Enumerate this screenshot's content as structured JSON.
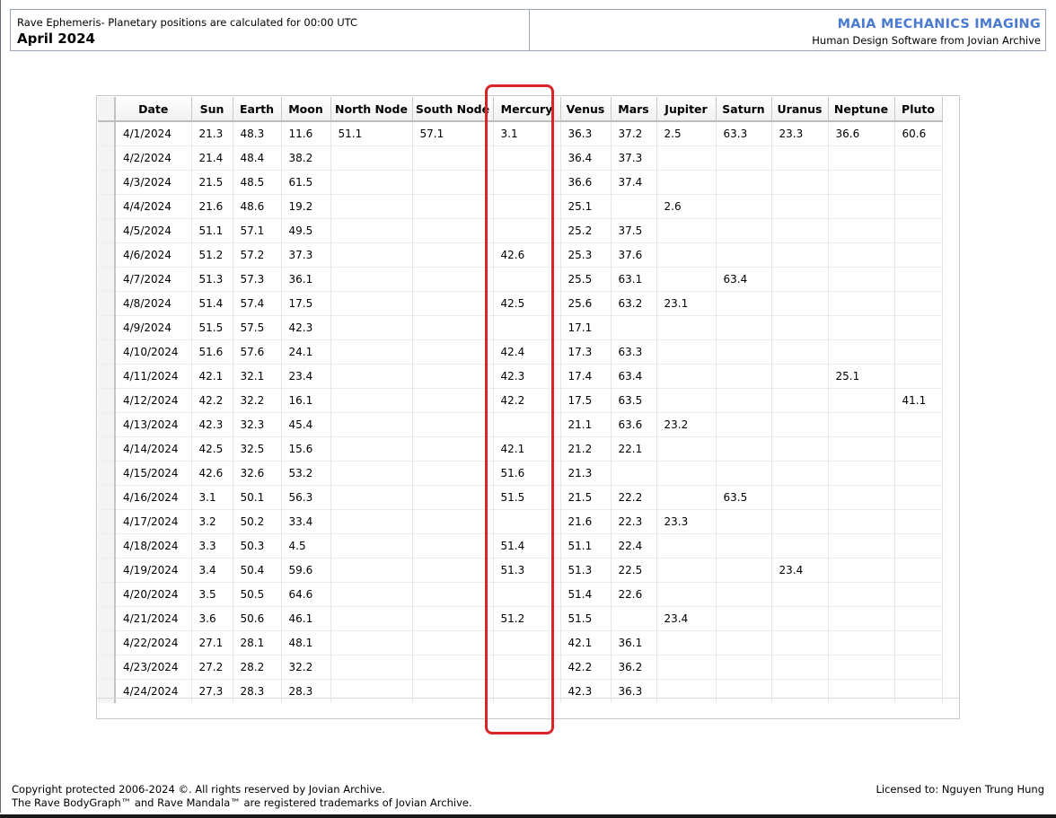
{
  "header": {
    "subtitle": "Rave Ephemeris- Planetary positions are calculated for 00:00 UTC",
    "title": "April 2024",
    "brand": "MAIA MECHANICS IMAGING",
    "tagline": "Human Design Software from Jovian Archive"
  },
  "table": {
    "columns": [
      "Date",
      "Sun",
      "Earth",
      "Moon",
      "North Node",
      "South Node",
      "Mercury",
      "Venus",
      "Mars",
      "Jupiter",
      "Saturn",
      "Uranus",
      "Neptune",
      "Pluto"
    ],
    "rows": [
      [
        "4/1/2024",
        "21.3",
        "48.3",
        "11.6",
        "51.1",
        "57.1",
        "3.1",
        "36.3",
        "37.2",
        "2.5",
        "63.3",
        "23.3",
        "36.6",
        "60.6"
      ],
      [
        "4/2/2024",
        "21.4",
        "48.4",
        "38.2",
        "",
        "",
        "",
        "36.4",
        "37.3",
        "",
        "",
        "",
        "",
        ""
      ],
      [
        "4/3/2024",
        "21.5",
        "48.5",
        "61.5",
        "",
        "",
        "",
        "36.6",
        "37.4",
        "",
        "",
        "",
        "",
        ""
      ],
      [
        "4/4/2024",
        "21.6",
        "48.6",
        "19.2",
        "",
        "",
        "",
        "25.1",
        "",
        "2.6",
        "",
        "",
        "",
        ""
      ],
      [
        "4/5/2024",
        "51.1",
        "57.1",
        "49.5",
        "",
        "",
        "",
        "25.2",
        "37.5",
        "",
        "",
        "",
        "",
        ""
      ],
      [
        "4/6/2024",
        "51.2",
        "57.2",
        "37.3",
        "",
        "",
        "42.6",
        "25.3",
        "37.6",
        "",
        "",
        "",
        "",
        ""
      ],
      [
        "4/7/2024",
        "51.3",
        "57.3",
        "36.1",
        "",
        "",
        "",
        "25.5",
        "63.1",
        "",
        "63.4",
        "",
        "",
        ""
      ],
      [
        "4/8/2024",
        "51.4",
        "57.4",
        "17.5",
        "",
        "",
        "42.5",
        "25.6",
        "63.2",
        "23.1",
        "",
        "",
        "",
        ""
      ],
      [
        "4/9/2024",
        "51.5",
        "57.5",
        "42.3",
        "",
        "",
        "",
        "17.1",
        "",
        "",
        "",
        "",
        "",
        ""
      ],
      [
        "4/10/2024",
        "51.6",
        "57.6",
        "24.1",
        "",
        "",
        "42.4",
        "17.3",
        "63.3",
        "",
        "",
        "",
        "",
        ""
      ],
      [
        "4/11/2024",
        "42.1",
        "32.1",
        "23.4",
        "",
        "",
        "42.3",
        "17.4",
        "63.4",
        "",
        "",
        "",
        "25.1",
        ""
      ],
      [
        "4/12/2024",
        "42.2",
        "32.2",
        "16.1",
        "",
        "",
        "42.2",
        "17.5",
        "63.5",
        "",
        "",
        "",
        "",
        "41.1"
      ],
      [
        "4/13/2024",
        "42.3",
        "32.3",
        "45.4",
        "",
        "",
        "",
        "21.1",
        "63.6",
        "23.2",
        "",
        "",
        "",
        ""
      ],
      [
        "4/14/2024",
        "42.5",
        "32.5",
        "15.6",
        "",
        "",
        "42.1",
        "21.2",
        "22.1",
        "",
        "",
        "",
        "",
        ""
      ],
      [
        "4/15/2024",
        "42.6",
        "32.6",
        "53.2",
        "",
        "",
        "51.6",
        "21.3",
        "",
        "",
        "",
        "",
        "",
        ""
      ],
      [
        "4/16/2024",
        "3.1",
        "50.1",
        "56.3",
        "",
        "",
        "51.5",
        "21.5",
        "22.2",
        "",
        "63.5",
        "",
        "",
        ""
      ],
      [
        "4/17/2024",
        "3.2",
        "50.2",
        "33.4",
        "",
        "",
        "",
        "21.6",
        "22.3",
        "23.3",
        "",
        "",
        "",
        ""
      ],
      [
        "4/18/2024",
        "3.3",
        "50.3",
        "4.5",
        "",
        "",
        "51.4",
        "51.1",
        "22.4",
        "",
        "",
        "",
        "",
        ""
      ],
      [
        "4/19/2024",
        "3.4",
        "50.4",
        "59.6",
        "",
        "",
        "51.3",
        "51.3",
        "22.5",
        "",
        "",
        "23.4",
        "",
        ""
      ],
      [
        "4/20/2024",
        "3.5",
        "50.5",
        "64.6",
        "",
        "",
        "",
        "51.4",
        "22.6",
        "",
        "",
        "",
        "",
        ""
      ],
      [
        "4/21/2024",
        "3.6",
        "50.6",
        "46.1",
        "",
        "",
        "51.2",
        "51.5",
        "",
        "23.4",
        "",
        "",
        "",
        ""
      ],
      [
        "4/22/2024",
        "27.1",
        "28.1",
        "48.1",
        "",
        "",
        "",
        "42.1",
        "36.1",
        "",
        "",
        "",
        "",
        ""
      ],
      [
        "4/23/2024",
        "27.2",
        "28.2",
        "32.2",
        "",
        "",
        "",
        "42.2",
        "36.2",
        "",
        "",
        "",
        "",
        ""
      ],
      [
        "4/24/2024",
        "27.3",
        "28.3",
        "28.3",
        "",
        "",
        "",
        "42.3",
        "36.3",
        "",
        "",
        "",
        "",
        ""
      ]
    ]
  },
  "footer": {
    "copyright": "Copyright protected 2006-2024 ©. All rights reserved by Jovian Archive.",
    "trademark": "The Rave BodyGraph™ and Rave Mandala™ are registered trademarks of Jovian Archive.",
    "license": "Licensed to: Nguyen Trung Hung"
  },
  "colors": {
    "brand": "#4a7bd0",
    "highlight": "#d9252a"
  }
}
